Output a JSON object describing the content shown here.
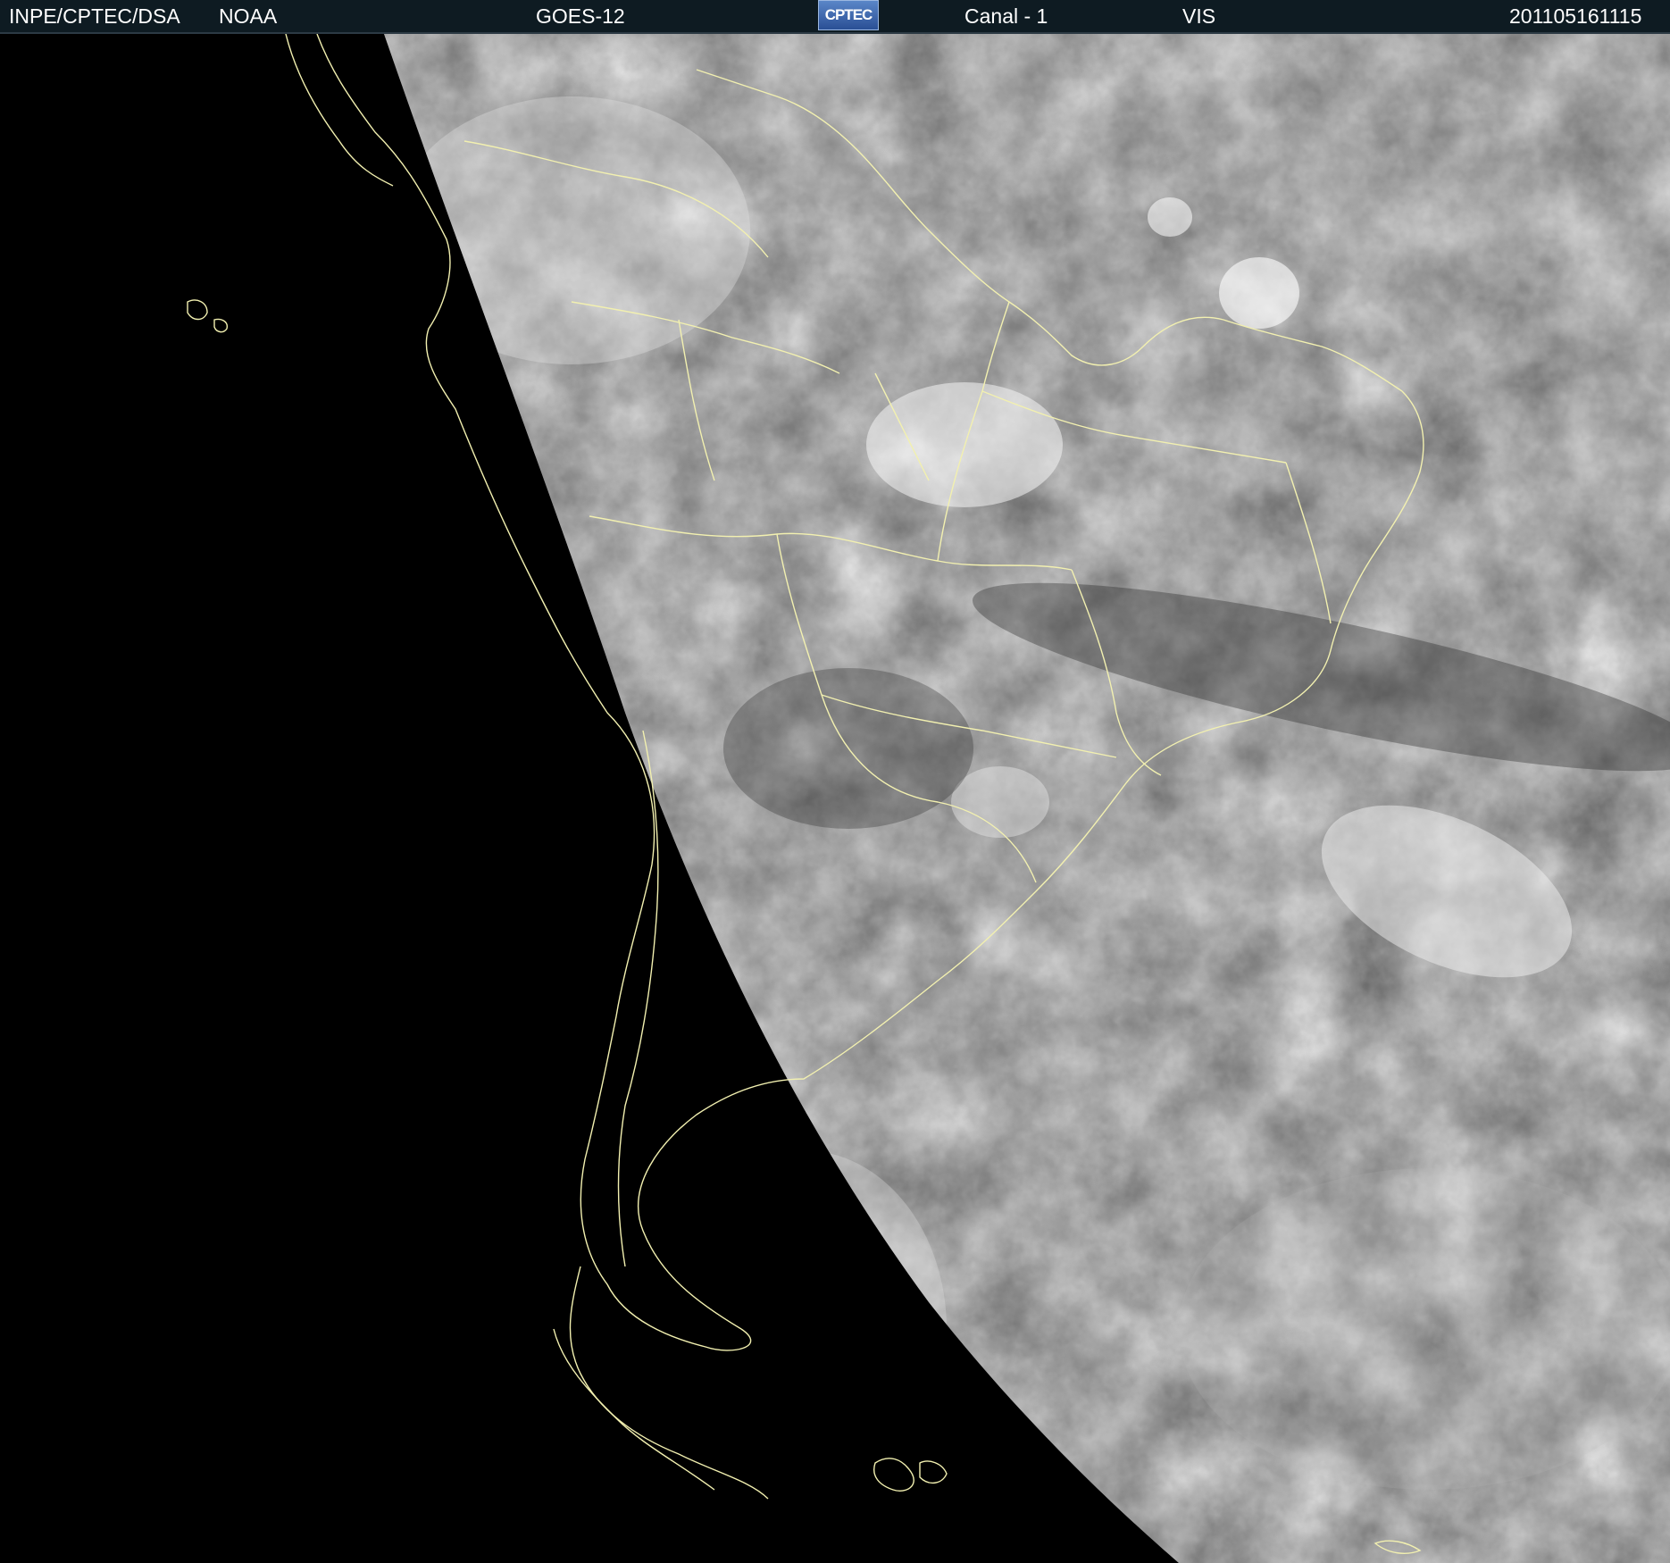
{
  "header": {
    "source": "INPE/CPTEC/DSA",
    "agency": "NOAA",
    "satellite": "GOES-12",
    "logo_text": "CPTEC",
    "channel": "Canal - 1",
    "band": "VIS",
    "timestamp": "201105161115"
  },
  "image": {
    "subject": "visible satellite image of South America and South Atlantic",
    "overlay_color": "#f2f0b0",
    "night_side_color": "#000000"
  }
}
